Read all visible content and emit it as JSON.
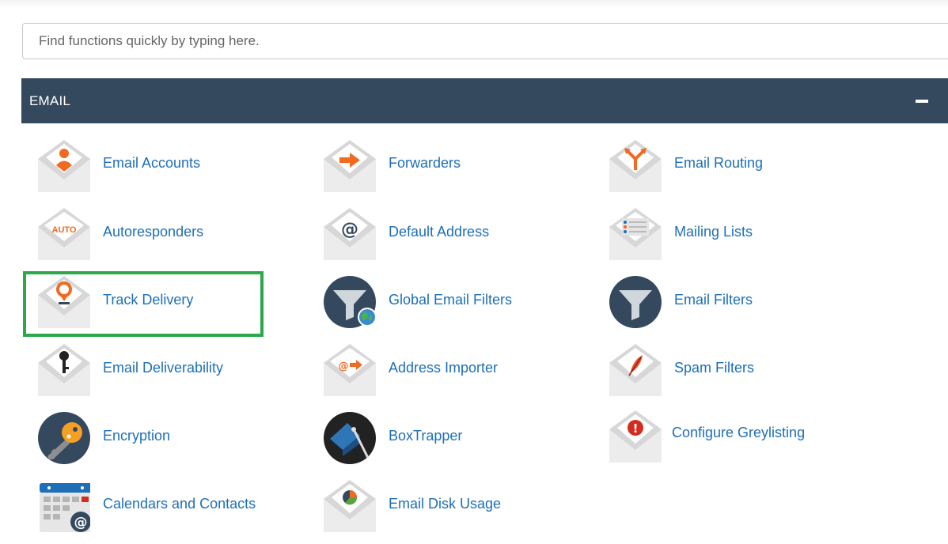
{
  "search": {
    "placeholder": "Find functions quickly by typing here."
  },
  "panel": {
    "title": "EMAIL"
  },
  "colors": {
    "header_bg": "#34495e",
    "link": "#1d6fb8",
    "icon_orange": "#f26a21",
    "highlight": "#2aa84a"
  },
  "items": [
    {
      "label": "Email Accounts",
      "icon": "user-envelope-icon"
    },
    {
      "label": "Forwarders",
      "icon": "arrow-envelope-icon"
    },
    {
      "label": "Email Routing",
      "icon": "route-envelope-icon"
    },
    {
      "label": "Autoresponders",
      "icon": "auto-envelope-icon",
      "badge": "AUTO"
    },
    {
      "label": "Default Address",
      "icon": "at-envelope-icon",
      "glyph": "@"
    },
    {
      "label": "Mailing Lists",
      "icon": "list-envelope-icon"
    },
    {
      "label": "Track Delivery",
      "icon": "pin-envelope-icon"
    },
    {
      "label": "Global Email Filters",
      "icon": "globe-funnel-icon"
    },
    {
      "label": "Email Filters",
      "icon": "funnel-icon"
    },
    {
      "label": "Email Deliverability",
      "icon": "key-envelope-icon"
    },
    {
      "label": "Address Importer",
      "icon": "import-envelope-icon",
      "glyph": "@"
    },
    {
      "label": "Spam Filters",
      "icon": "feather-envelope-icon"
    },
    {
      "label": "Encryption",
      "icon": "key-icon"
    },
    {
      "label": "BoxTrapper",
      "icon": "trap-icon"
    },
    {
      "label": "Configure Greylisting",
      "icon": "alert-envelope-icon",
      "glyph": "!"
    },
    {
      "label": "Calendars and Contacts",
      "icon": "calendar-icon",
      "glyph": "@"
    },
    {
      "label": "Email Disk Usage",
      "icon": "pie-envelope-icon"
    }
  ]
}
